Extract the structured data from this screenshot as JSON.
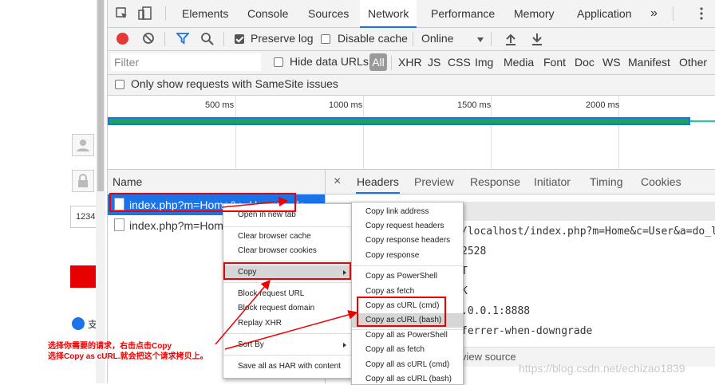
{
  "page": {
    "input_value": "1234",
    "partial_text": "支"
  },
  "devtools": {
    "tabs": [
      "Elements",
      "Console",
      "Sources",
      "Network",
      "Performance",
      "Memory",
      "Application"
    ],
    "more_tabs": "»",
    "active_tab": "Network",
    "toolbar": {
      "preserve_log": "Preserve log",
      "disable_cache": "Disable cache",
      "throttle": "Online"
    },
    "filter": {
      "placeholder": "Filter",
      "hide_data_urls": "Hide data URLs",
      "types": [
        "All",
        "XHR",
        "JS",
        "CSS",
        "Img",
        "Media",
        "Font",
        "Doc",
        "WS",
        "Manifest",
        "Other"
      ]
    },
    "samesite": "Only show requests with SameSite issues",
    "timeline": {
      "ticks": [
        "500 ms",
        "1000 ms",
        "1500 ms",
        "2000 ms"
      ]
    },
    "requests": {
      "header": "Name",
      "rows": [
        "index.php?m=Home&c=User&a=do",
        "index.php?m=Hom"
      ]
    },
    "detail": {
      "close": "×",
      "tabs": [
        "Headers",
        "Preview",
        "Response",
        "Initiator",
        "Timing",
        "Cookies"
      ],
      "values": [
        "/localhost/index.php?m=Home&c=User&a=do_log",
        "2528",
        "T",
        "K",
        ".0.0.1:8888",
        "ferrer-when-downgrade"
      ],
      "view_source": "view source",
      "watermark": "https://blog.csdn.net/echizao1839",
      "bottom_partial": "                            "
    }
  },
  "context_menu": {
    "items": [
      "Open in new tab",
      "Clear browser cache",
      "Clear browser cookies",
      "Copy",
      "Block request URL",
      "Block request domain",
      "Replay XHR",
      "Sort By",
      "Save all as HAR with content"
    ]
  },
  "copy_submenu": {
    "items": [
      "Copy link address",
      "Copy request headers",
      "Copy response headers",
      "Copy response",
      "Copy as PowerShell",
      "Copy as fetch",
      "Copy as cURL (cmd)",
      "Copy as cURL (bash)",
      "Copy all as PowerShell",
      "Copy all as fetch",
      "Copy all as cURL (cmd)",
      "Copy all as cURL (bash)"
    ]
  },
  "annotation": {
    "line1": "选择你需要的请求，右击点击Copy",
    "line2": "选择Copy as cURL.就会把这个请求拷贝上。"
  },
  "colors": {
    "accent": "#1a73e8",
    "record": "#e53935",
    "annotation": "#ee0000"
  }
}
